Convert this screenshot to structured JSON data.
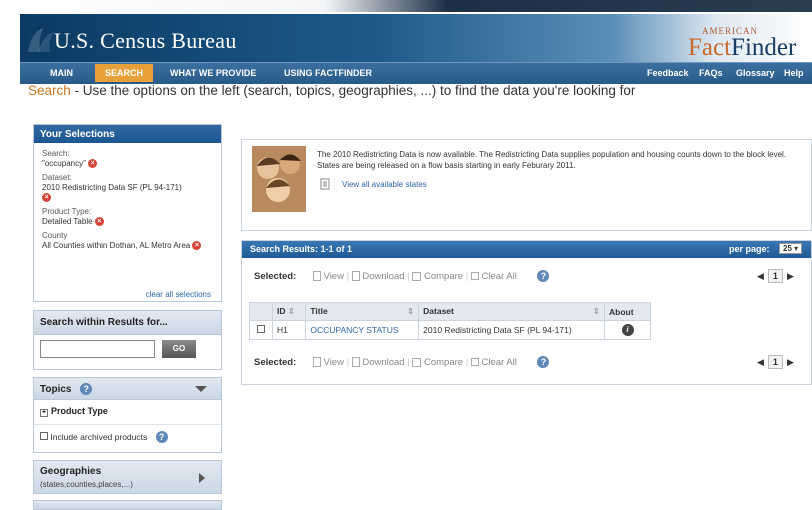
{
  "header": {
    "agency": "U.S. Census Bureau",
    "brand_small": "AMERICAN",
    "brand_main": "FactFinder"
  },
  "nav": {
    "items": [
      "MAIN",
      "SEARCH",
      "WHAT WE PROVIDE",
      "USING FACTFINDER"
    ],
    "right": [
      "Feedback",
      "FAQs",
      "Glossary",
      "Help"
    ],
    "active": "SEARCH"
  },
  "page": {
    "title_word": "Search",
    "title_rest": " - Use the options on the left (search, topics, geographies, ...) to find the data you're looking for"
  },
  "selections": {
    "title": "Your Selections",
    "search_label": "Search:",
    "search_value": "\"occupancy\"",
    "dataset_label": "Dataset:",
    "dataset_value": "2010 Redistricting Data SF (PL 94-171)",
    "product_label": "Product Type:",
    "product_value": "Detailed Table",
    "county_label": "County",
    "county_value": "All Counties within Dothan, AL  Metro Area",
    "clear_all": "clear all selections",
    "remove_glyph": "×"
  },
  "search_within": {
    "title": "Search within Results for...",
    "input_value": "",
    "go": "GO"
  },
  "topics": {
    "title": "Topics",
    "product_type": "Product Type",
    "include_archived": "Include archived products",
    "help": "?"
  },
  "geographies": {
    "title": "Geographies",
    "subtitle": "(states,counties,places,...)"
  },
  "notice": {
    "text": "The 2010 Redistricting Data is now available. The Redistricting Data supplies population and housing counts down to the block level. States are being released on a flow basis starting in early Feburary 2011.",
    "link": "View all available states"
  },
  "results": {
    "title": "Search Results:  1-1  of  1",
    "per_page_label": "per page:",
    "per_page_value": "25",
    "toolbar": {
      "selected": "Selected:",
      "view": "View",
      "download": "Download",
      "compare": "Compare",
      "clear_all": "Clear All"
    },
    "page_number": "1",
    "columns": [
      "ID",
      "Title",
      "Dataset",
      "About"
    ],
    "rows": [
      {
        "id": "H1",
        "title": "OCCUPANCY STATUS",
        "dataset": "2010 Redistricting Data SF (PL 94-171)",
        "about": "i"
      }
    ]
  },
  "colors": {
    "accent": "#e8a13a",
    "blue_header": "#1d5590",
    "link": "#2d66a8"
  }
}
